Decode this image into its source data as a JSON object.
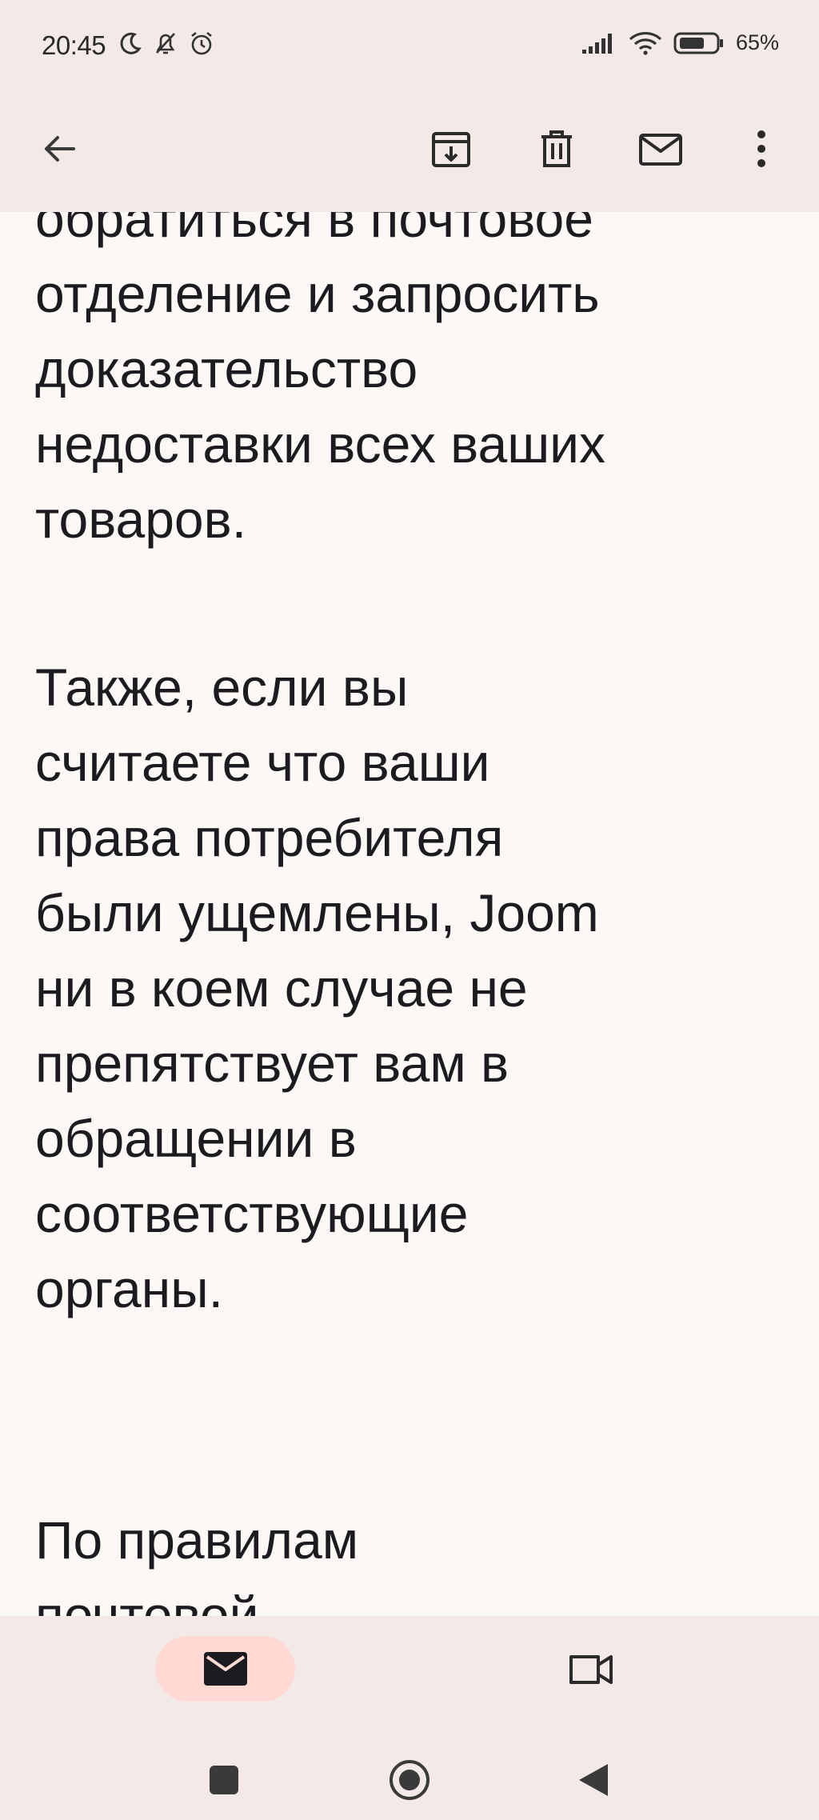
{
  "status_bar": {
    "time": "20:45",
    "battery_percent": "65%",
    "icons_left": [
      "moon-icon",
      "bell-off-icon",
      "alarm-icon"
    ],
    "icons_right": [
      "signal-icon",
      "wifi-icon",
      "battery-icon"
    ]
  },
  "toolbar": {
    "back": "back-arrow-icon",
    "actions": [
      "archive-icon",
      "delete-icon",
      "mark-unread-icon",
      "more-icon"
    ]
  },
  "email": {
    "paragraphs": [
      "обратиться в почтовое\nотделение и запросить\nдоказательство\nнедоставки всех ваших\nтоваров.",
      "Также, если вы\nсчитаете что ваши\nправа потребителя\nбыли ущемлены, Joom\nни в коем случае не\nпрепятствует вам в\nобращении в\nсоответствующие\nорганы.",
      "По правилам\nпочтовой"
    ]
  },
  "bottom_nav": {
    "items": [
      "mail-icon",
      "video-call-icon"
    ],
    "selected": "mail-icon"
  },
  "system_nav": [
    "recents-icon",
    "home-icon",
    "back-icon"
  ],
  "colors": {
    "bar_background": "#f3e9e6",
    "page_background": "#fcf8f6",
    "selected_pill": "#ffdad4",
    "text": "#1c1b1f"
  }
}
